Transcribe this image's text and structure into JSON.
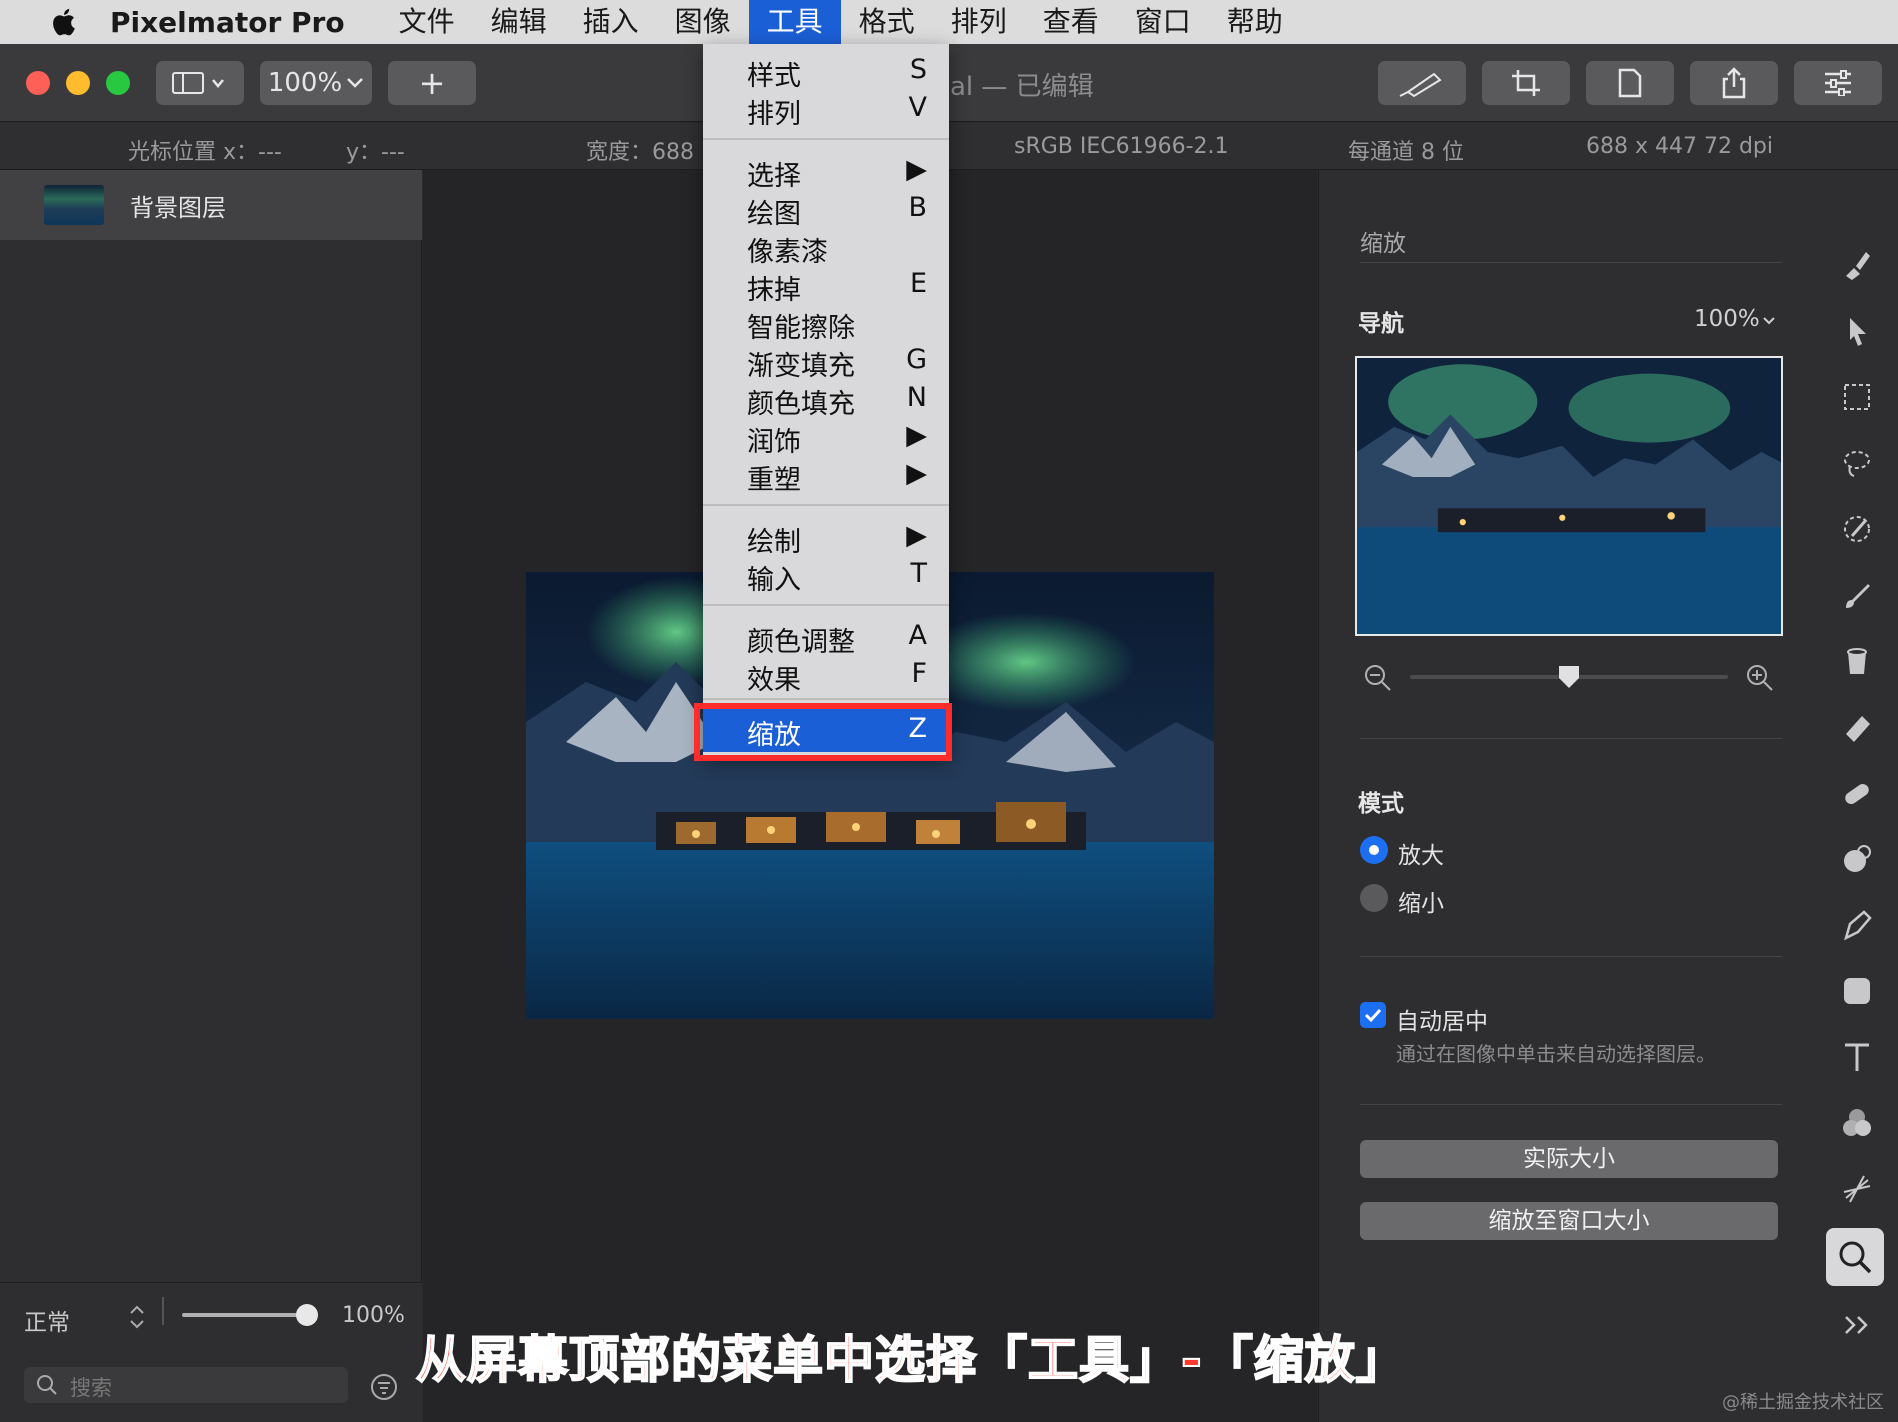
{
  "menubar": {
    "app_name": "Pixelmator Pro",
    "items": [
      "文件",
      "编辑",
      "插入",
      "图像",
      "工具",
      "格式",
      "排列",
      "查看",
      "窗口",
      "帮助"
    ],
    "active": "工具"
  },
  "toolbar": {
    "zoom": "100%",
    "add": "+",
    "title": "al — 已编辑"
  },
  "infobar": {
    "cursor_x": "光标位置 x：---",
    "cursor_y": "y：---",
    "width": "宽度：688",
    "color_profile": "sRGB IEC61966-2.1",
    "bit_depth": "每通道 8 位",
    "dimensions": "688 x 447 72 dpi"
  },
  "layers": {
    "items": [
      {
        "name": "背景图层"
      }
    ],
    "blend_mode": "正常",
    "opacity": "100%",
    "search_placeholder": "搜索"
  },
  "tool_menu": {
    "items": [
      {
        "label": "样式",
        "key": "S"
      },
      {
        "label": "排列",
        "key": "V"
      },
      {
        "label": "选择",
        "key": "▶"
      },
      {
        "label": "绘图",
        "key": "B"
      },
      {
        "label": "像素漆",
        "key": ""
      },
      {
        "label": "抹掉",
        "key": "E"
      },
      {
        "label": "智能擦除",
        "key": ""
      },
      {
        "label": "渐变填充",
        "key": "G"
      },
      {
        "label": "颜色填充",
        "key": "N"
      },
      {
        "label": "润饰",
        "key": "▶"
      },
      {
        "label": "重塑",
        "key": "▶"
      },
      {
        "label": "绘制",
        "key": "▶"
      },
      {
        "label": "输入",
        "key": "T"
      },
      {
        "label": "颜色调整",
        "key": "A"
      },
      {
        "label": "效果",
        "key": "F"
      },
      {
        "label": "缩放",
        "key": "Z"
      }
    ],
    "highlighted": "缩放"
  },
  "inspector": {
    "header": "缩放",
    "nav_label": "导航",
    "nav_zoom": "100%",
    "zoom_slider_level": 0.5,
    "mode_label": "模式",
    "mode_options": [
      "放大",
      "缩小"
    ],
    "mode_selected": "放大",
    "auto_center_label": "自动居中",
    "auto_center_checked": true,
    "auto_center_desc": "通过在图像中单击来自动选择图层。",
    "actual_size_button": "实际大小",
    "fit_window_button": "缩放至窗口大小"
  },
  "caption": "从屏幕顶部的菜单中选择「工具」-「缩放」",
  "watermark": "@稀土掘金技术社区",
  "colors": {
    "accent": "#1b5fd6",
    "highlight_box": "#ff2c2c",
    "caption": "#ff3b2f"
  }
}
